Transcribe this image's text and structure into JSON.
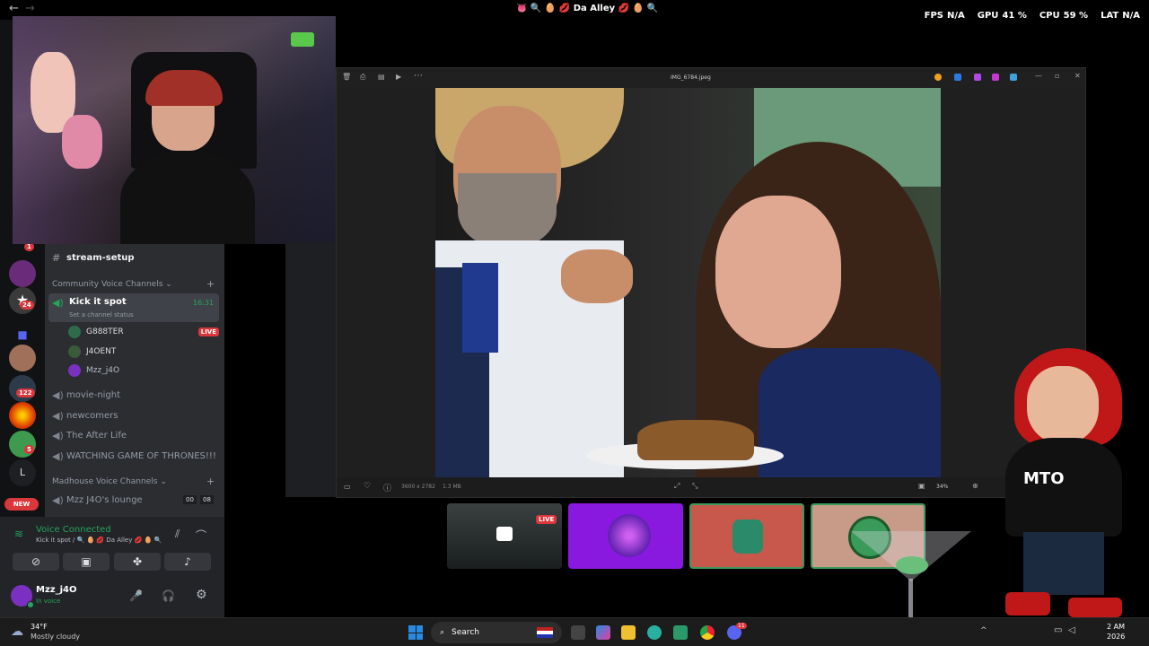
{
  "topbar": {
    "back": "←",
    "forward": "→",
    "title": "👅 🔍 🥚 💋 Da Alley 💋 🥚 🔍",
    "stats": [
      {
        "label": "FPS",
        "value": "N/A"
      },
      {
        "label": "GPU",
        "value": "41 %"
      },
      {
        "label": "CPU",
        "value": "59 %"
      },
      {
        "label": "LAT",
        "value": "N/A"
      }
    ]
  },
  "servers": {
    "badges": [
      "1",
      "24",
      "122",
      "5"
    ],
    "letter": "L",
    "new_label": "NEW"
  },
  "channels": {
    "stream_setup": "stream-setup",
    "cat_community": "Community Voice Channels",
    "kick_it_spot": "Kick it spot",
    "kick_time": "16:31",
    "channel_status": "Set a channel status",
    "voice_users": [
      {
        "name": "G888TER",
        "live": "LIVE"
      },
      {
        "name": "J4OENT",
        "live": ""
      },
      {
        "name": "Mzz_j4O",
        "live": ""
      }
    ],
    "movie_night": "movie-night",
    "newcomers": "newcomers",
    "after_life": "The After Life",
    "got": "WATCHING GAME OF THRONES!!!",
    "cat_madhouse": "Madhouse Voice Channels",
    "lounge": "Mzz J4O's lounge",
    "lounge_count_a": "00",
    "lounge_count_b": "08"
  },
  "voice": {
    "status": "Voice Connected",
    "location": "Kick it spot / 🔍 🥚 💋 Da Alley 💋 🥚 🔍"
  },
  "user": {
    "name": "Mzz_j4O",
    "status": "In voice"
  },
  "viewer": {
    "filename": "IMG_6784.jpeg",
    "dimensions": "3600 x 2782",
    "size": "1.3 MB",
    "zoom": "34%"
  },
  "tiles": {
    "live": "LIVE"
  },
  "overlay": {
    "mto": "MTO"
  },
  "taskbar": {
    "weather_temp": "34°F",
    "weather_desc": "Mostly cloudy",
    "search": "Search",
    "time": "2 AM",
    "date": "2026",
    "discord_badge": "11"
  },
  "colors": {
    "discord_bg": "#2b2d31",
    "server_bg": "#111214",
    "green": "#23a55a",
    "red": "#da373c",
    "purple_tile": "#8a19e0",
    "salmon_tile": "#c8584c"
  }
}
